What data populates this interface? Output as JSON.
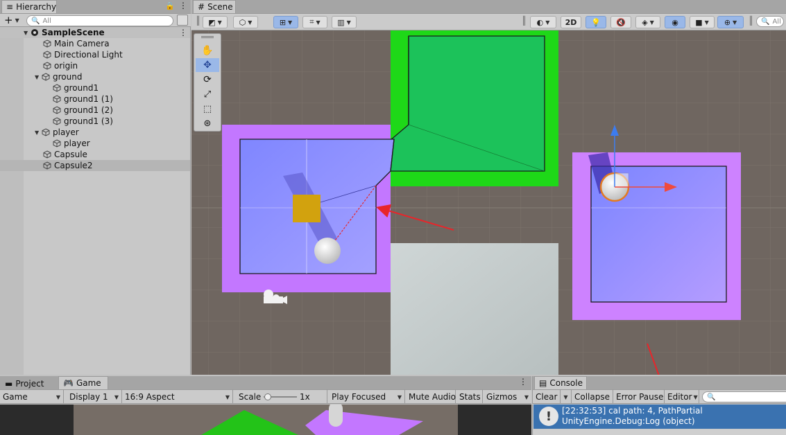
{
  "hierarchy": {
    "tab_label": "Hierarchy",
    "add_label": "+",
    "search_placeholder": "All",
    "scene_name": "SampleScene",
    "items": [
      {
        "label": "Main Camera"
      },
      {
        "label": "Directional Light"
      },
      {
        "label": "origin"
      },
      {
        "label": "ground"
      },
      {
        "label": "ground1"
      },
      {
        "label": "ground1 (1)"
      },
      {
        "label": "ground1 (2)"
      },
      {
        "label": "ground1 (3)"
      },
      {
        "label": "player"
      },
      {
        "label": "player"
      },
      {
        "label": "Capsule"
      },
      {
        "label": "Capsule2"
      }
    ]
  },
  "scene": {
    "tab_label": "Scene",
    "mode_2d": "2D",
    "search_placeholder": "All"
  },
  "bottom": {
    "project_tab": "Project",
    "game_tab": "Game",
    "game_dropdown": "Game",
    "display": "Display 1",
    "aspect": "16:9 Aspect",
    "scale_label": "Scale",
    "scale_value": "1x",
    "play_focused": "Play Focused",
    "mute_audio": "Mute Audio",
    "stats": "Stats",
    "gizmos": "Gizmos"
  },
  "console": {
    "tab_label": "Console",
    "clear": "Clear",
    "collapse": "Collapse",
    "error_pause": "Error Pause",
    "editor": "Editor",
    "entries": [
      {
        "line1": "[22:32:53] cal path: 4, PathPartial",
        "line2": "UnityEngine.Debug:Log (object)"
      }
    ]
  },
  "colors": {
    "accent_blue": "#3a72b0",
    "green_ground": "#1ed818",
    "purple_ground": "#c377ff",
    "blue_plane": "#8f8cff",
    "annotation_red": "#e8252a"
  }
}
